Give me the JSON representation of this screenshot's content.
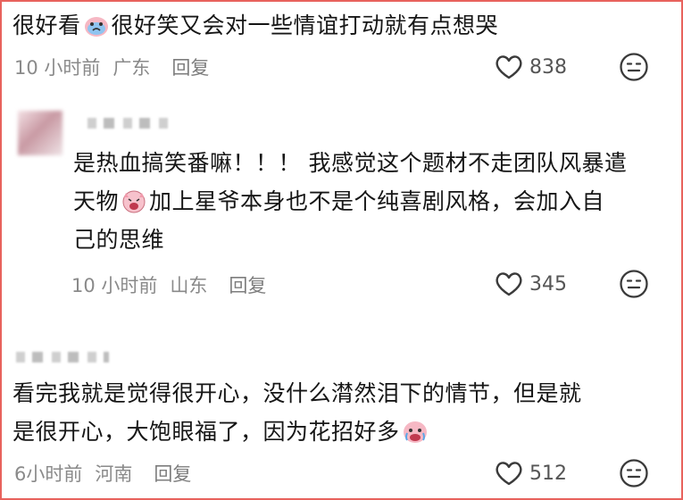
{
  "comments": [
    {
      "text_parts": [
        "很好看",
        "很好笑又会对一些情谊打动就有点想哭"
      ],
      "emoji": "crying-face-emoji",
      "time": "10 小时前",
      "location": "广东",
      "reply": "回复",
      "likes": "838"
    },
    {
      "line1": "是热血搞笑番嘛！！！ 我感觉这个题材不走团队风暴遣",
      "line2_parts": [
        "天物",
        "加上星爷本身也不是个纯喜剧风格，会加入自"
      ],
      "line3": "己的思维",
      "emoji": "laughing-pig-emoji",
      "time": "10 小时前",
      "location": "山东",
      "reply": "回复",
      "likes": "345"
    },
    {
      "line1": "看完我就是觉得很开心，没什么潸然泪下的情节，但是就",
      "line2": "是很开心，大饱眼福了，因为花招好多",
      "emoji": "crying-face-emoji",
      "time": "6小时前",
      "location": "河南",
      "reply": "回复",
      "likes": "512"
    }
  ],
  "colors": {
    "border": "#e8625d",
    "text": "#161616",
    "meta": "#8a8a8a"
  },
  "icons": [
    "heart-outline-icon",
    "sticker-face-icon"
  ]
}
